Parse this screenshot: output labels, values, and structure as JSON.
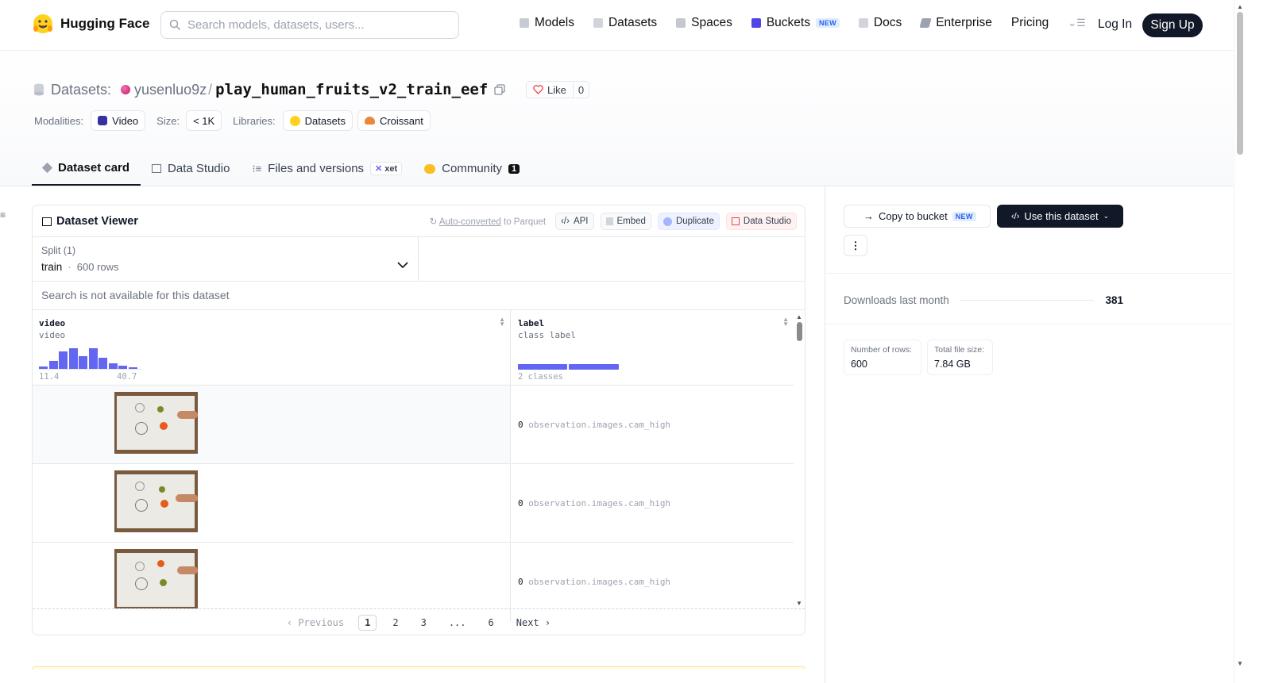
{
  "nav": {
    "brand": "Hugging Face",
    "search_placeholder": "Search models, datasets, users...",
    "links": [
      {
        "label": "Models"
      },
      {
        "label": "Datasets"
      },
      {
        "label": "Spaces"
      },
      {
        "label": "Buckets",
        "badge": "NEW"
      },
      {
        "label": "Docs"
      },
      {
        "label": "Enterprise"
      },
      {
        "label": "Pricing"
      }
    ],
    "login": "Log In",
    "signup": "Sign Up"
  },
  "repo": {
    "section": "Datasets:",
    "owner": "yusenluo9z",
    "separator": "/",
    "name": "play_human_fruits_v2_train_eef",
    "like_label": "Like",
    "like_count": "0"
  },
  "meta": {
    "modalities_label": "Modalities:",
    "modality": "Video",
    "size_label": "Size:",
    "size": "< 1K",
    "libraries_label": "Libraries:",
    "lib1": "Datasets",
    "lib2": "Croissant"
  },
  "tabs": [
    {
      "label": "Dataset card"
    },
    {
      "label": "Data Studio"
    },
    {
      "label": "Files and versions",
      "badge": "xet"
    },
    {
      "label": "Community",
      "count": "1"
    }
  ],
  "viewer": {
    "title": "Dataset Viewer",
    "auto_converted": "Auto-converted",
    "auto_suffix": "to Parquet",
    "api": "API",
    "embed": "Embed",
    "duplicate": "Duplicate",
    "data_studio": "Data Studio",
    "split_label": "Split (1)",
    "split_value": "train",
    "split_rows": "600 rows",
    "search_na": "Search is not available for this dataset",
    "columns": [
      {
        "name": "video",
        "type": "video",
        "min": "11.4",
        "max": "40.7"
      },
      {
        "name": "label",
        "type": "class label",
        "summary": "2 classes"
      }
    ],
    "histogram": [
      0.1,
      0.38,
      0.85,
      1.0,
      0.6,
      1.0,
      0.55,
      0.25,
      0.15,
      0.08
    ],
    "rows": [
      {
        "label_index": "0",
        "label_text": "observation.images.cam_high"
      },
      {
        "label_index": "0",
        "label_text": "observation.images.cam_high"
      },
      {
        "label_index": "0",
        "label_text": "observation.images.cam_high"
      }
    ],
    "pager": {
      "prev": "Previous",
      "pages": [
        "1",
        "2",
        "3",
        "...",
        "6"
      ],
      "next": "Next",
      "current": "1"
    }
  },
  "sidebar": {
    "copy_bucket": "Copy to bucket",
    "copy_badge": "NEW",
    "use_dataset": "Use this dataset",
    "downloads_label": "Downloads last month",
    "downloads": "381",
    "rows_label": "Number of rows:",
    "rows": "600",
    "filesize_label": "Total file size:",
    "filesize": "7.84 GB"
  },
  "colors": {
    "accent": "#6366f1",
    "dark": "#111827"
  }
}
